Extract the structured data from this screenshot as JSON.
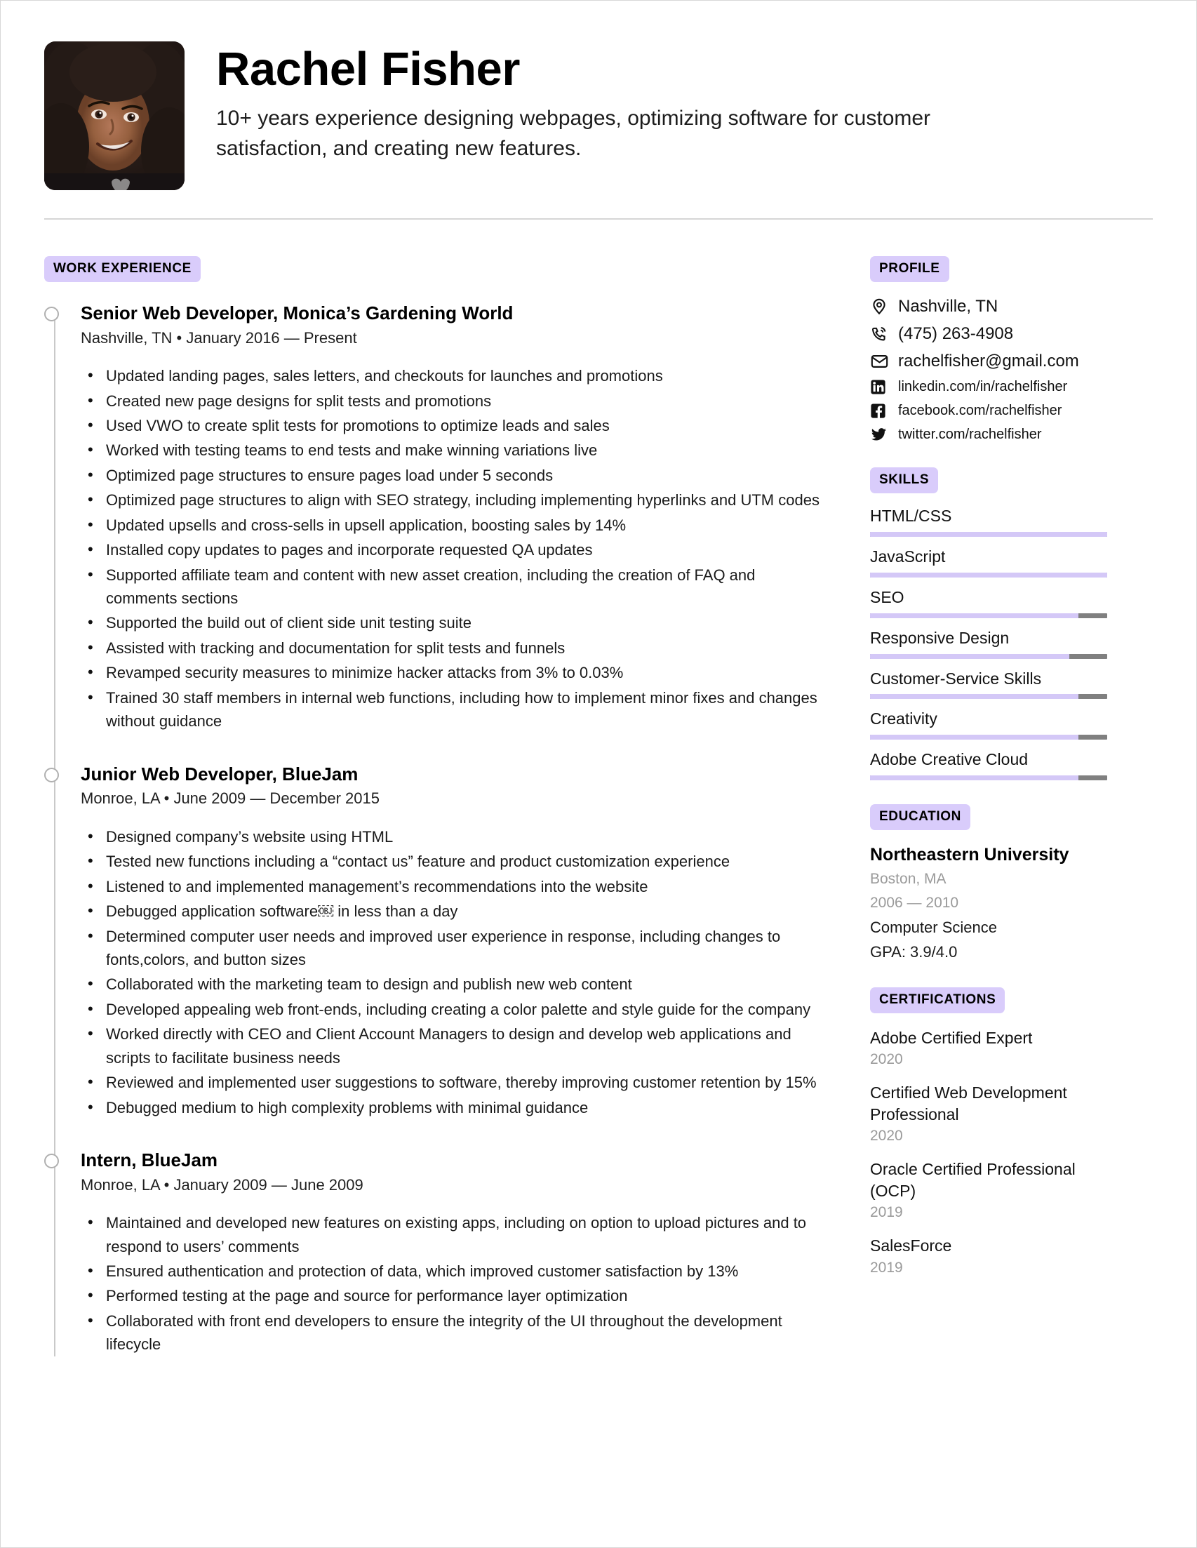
{
  "header": {
    "name": "Rachel Fisher",
    "tagline": "10+ years experience designing webpages, optimizing software for customer satisfaction, and creating new features.",
    "avatar_alt": "profile-photo"
  },
  "theme": {
    "badge_bg": "#d9ccfb",
    "skill_fill": "#d4c8f7",
    "skill_track": "#808080",
    "muted_text": "#9a9a9a",
    "divider": "#d6d6d6"
  },
  "main": {
    "section_label": "WORK EXPERIENCE",
    "jobs": [
      {
        "title": "Senior Web Developer, Monica’s Gardening World",
        "meta": "Nashville, TN • January 2016 — Present",
        "bullets": [
          "Updated landing pages, sales letters, and checkouts for launches and promotions",
          "Created new page designs for split tests and promotions",
          "Used VWO to create split tests for promotions to optimize leads and sales",
          "Worked with testing teams to end tests and make winning variations live",
          "Optimized page structures to ensure pages load under 5 seconds",
          "Optimized page structures to align with SEO strategy, including implementing hyperlinks and UTM codes",
          "Updated upsells and cross-sells in upsell application, boosting sales by 14%",
          "Installed copy updates to pages and incorporate requested QA updates",
          "Supported affiliate team and content with new asset creation, including the creation of FAQ and comments sections",
          "Supported the build out of client side unit testing suite",
          "Assisted with tracking and documentation for split tests and funnels",
          "Revamped security measures to minimize hacker attacks from 3% to 0.03%",
          "Trained 30 staff members in internal web functions, including how to implement minor fixes and changes without guidance"
        ]
      },
      {
        "title": "Junior Web Developer, BlueJam",
        "meta": "Monroe, LA • June 2009 — December 2015",
        "bullets": [
          "Designed company’s website using HTML",
          "Tested new functions including a “contact us” feature and product customization experience",
          "Listened to and implemented management’s recommendations into the website",
          "Debugged application software￼ in less than a day",
          "Determined computer user needs and improved user experience in response, including changes to fonts,colors, and button sizes",
          "Collaborated with the marketing team to design and publish new web content",
          "Developed appealing web front-ends, including creating a color palette and style guide for the company",
          "Worked directly with CEO and Client Account Managers to design and develop web applications and scripts to facilitate business needs",
          "Reviewed and implemented user suggestions to software, thereby improving customer retention by 15%",
          "Debugged medium to high complexity problems with minimal guidance"
        ]
      },
      {
        "title": "Intern, BlueJam",
        "meta": "Monroe, LA • January 2009 — June 2009",
        "bullets": [
          "Maintained and developed new features on existing apps, including on option to upload pictures and to respond to users’ comments",
          "Ensured authentication and protection of data, which improved customer satisfaction by 13%",
          "Performed testing at the page and source for performance layer optimization",
          "Collaborated with front end developers to ensure the integrity of the UI throughout the development lifecycle"
        ]
      }
    ]
  },
  "sidebar": {
    "profile": {
      "label": "PROFILE",
      "items": [
        {
          "icon": "location-pin-icon",
          "text": "Nashville, TN",
          "size": "normal"
        },
        {
          "icon": "phone-icon",
          "text": "(475) 263-4908",
          "size": "normal"
        },
        {
          "icon": "envelope-icon",
          "text": "rachelfisher@gmail.com",
          "size": "normal"
        },
        {
          "icon": "linkedin-icon",
          "text": "linkedin.com/in/rachelfisher",
          "size": "small"
        },
        {
          "icon": "facebook-icon",
          "text": "facebook.com/rachelfisher",
          "size": "small"
        },
        {
          "icon": "twitter-icon",
          "text": "twitter.com/rachelfisher",
          "size": "small"
        }
      ]
    },
    "skills": {
      "label": "SKILLS",
      "items": [
        {
          "name": "HTML/CSS",
          "level": 100
        },
        {
          "name": "JavaScript",
          "level": 100
        },
        {
          "name": "SEO",
          "level": 88
        },
        {
          "name": "Responsive Design",
          "level": 84
        },
        {
          "name": "Customer-Service Skills",
          "level": 88
        },
        {
          "name": "Creativity",
          "level": 88
        },
        {
          "name": "Adobe Creative Cloud",
          "level": 88
        }
      ]
    },
    "education": {
      "label": "EDUCATION",
      "school": "Northeastern University",
      "location": "Boston, MA",
      "years": "2006 — 2010",
      "degree": "Computer Science",
      "gpa": "GPA: 3.9/4.0"
    },
    "certifications": {
      "label": "CERTIFICATIONS",
      "items": [
        {
          "name": "Adobe Certified Expert",
          "year": "2020"
        },
        {
          "name": "Certified Web Development Professional",
          "year": "2020"
        },
        {
          "name": "Oracle Certified Professional (OCP)",
          "year": "2019"
        },
        {
          "name": "SalesForce",
          "year": "2019"
        }
      ]
    }
  }
}
